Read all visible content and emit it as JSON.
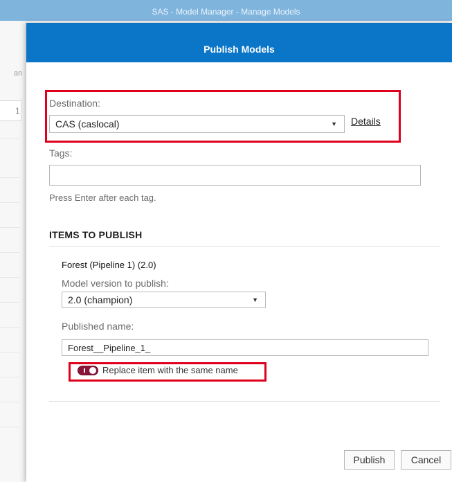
{
  "window": {
    "title": "SAS - Model Manager - Manage Models"
  },
  "background": {
    "left_fragment_1": "an",
    "left_fragment_2": "1"
  },
  "dialog": {
    "title": "Publish Models",
    "destination": {
      "label": "Destination:",
      "value": "CAS (caslocal)",
      "details_link": "Details"
    },
    "tags": {
      "label": "Tags:",
      "value": "",
      "hint": "Press Enter after each tag."
    },
    "items_section": {
      "title": "ITEMS TO PUBLISH",
      "item_name": "Forest (Pipeline 1) (2.0)",
      "version_label": "Model version to publish:",
      "version_value": "2.0 (champion)",
      "published_name_label": "Published name:",
      "published_name_value": "Forest__Pipeline_1_",
      "replace_toggle": {
        "label": "Replace item with the same name",
        "on": true
      }
    },
    "buttons": {
      "publish": "Publish",
      "cancel": "Cancel"
    }
  },
  "colors": {
    "header": "#0b76c8",
    "highlight": "#e0001b",
    "toggle_on": "#8a1538"
  }
}
